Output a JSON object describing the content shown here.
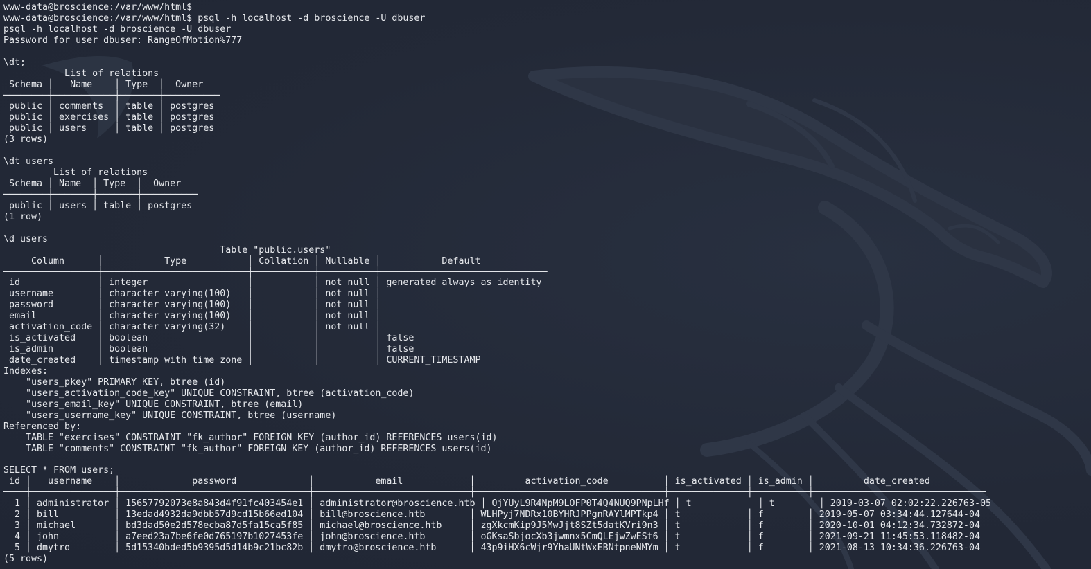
{
  "terminal": {
    "lines": [
      "www-data@broscience:/var/www/html$",
      "www-data@broscience:/var/www/html$ psql -h localhost -d broscience -U dbuser",
      "psql -h localhost -d broscience -U dbuser",
      "Password for user dbuser: RangeOfMotion%777",
      "",
      "\\dt;",
      "           List of relations",
      " Schema │   Name    │ Type  │  Owner",
      "────────┼───────────┼───────┼──────────",
      " public │ comments  │ table │ postgres",
      " public │ exercises │ table │ postgres",
      " public │ users     │ table │ postgres",
      "(3 rows)",
      "",
      "\\dt users",
      "         List of relations",
      " Schema │ Name  │ Type  │  Owner",
      "────────┼───────┼───────┼──────────",
      " public │ users │ table │ postgres",
      "(1 row)",
      "",
      "\\d users",
      "                                       Table \"public.users\"",
      "     Column      │           Type           │ Collation │ Nullable │           Default",
      "─────────────────┼──────────────────────────┼───────────┼──────────┼──────────────────────────────",
      " id              │ integer                  │           │ not null │ generated always as identity",
      " username        │ character varying(100)   │           │ not null │",
      " password        │ character varying(100)   │           │ not null │",
      " email           │ character varying(100)   │           │ not null │",
      " activation_code │ character varying(32)    │           │ not null │",
      " is_activated    │ boolean                  │           │          │ false",
      " is_admin        │ boolean                  │           │          │ false",
      " date_created    │ timestamp with time zone │           │          │ CURRENT_TIMESTAMP",
      "Indexes:",
      "    \"users_pkey\" PRIMARY KEY, btree (id)",
      "    \"users_activation_code_key\" UNIQUE CONSTRAINT, btree (activation_code)",
      "    \"users_email_key\" UNIQUE CONSTRAINT, btree (email)",
      "    \"users_username_key\" UNIQUE CONSTRAINT, btree (username)",
      "Referenced by:",
      "    TABLE \"exercises\" CONSTRAINT \"fk_author\" FOREIGN KEY (author_id) REFERENCES users(id)",
      "    TABLE \"comments\" CONSTRAINT \"fk_author\" FOREIGN KEY (author_id) REFERENCES users(id)",
      "",
      "SELECT * FROM users;",
      " id │   username    │             password             │           email            │         activation_code          │ is_activated │ is_admin │         date_created",
      "────┼───────────────┼──────────────────────────────────┼────────────────────────────┼──────────────────────────────────┼──────────────┼──────────┼───────────────────────────────",
      "  1 │ administrator │ 15657792073e8a843d4f91fc403454e1 │ administrator@broscience.htb │ OjYUyL9R4NpM9LOFP0T4Q4NUQ9PNpLHf │ t            │ t        │ 2019-03-07 02:02:22.226763-05",
      "  2 │ bill          │ 13edad4932da9dbb57d9cd15b66ed104 │ bill@broscience.htb        │ WLHPyj7NDRx10BYHRJPPgnRAYlMPTkp4 │ t            │ f        │ 2019-05-07 03:34:44.127644-04",
      "  3 │ michael       │ bd3dad50e2d578ecba87d5fa15ca5f85 │ michael@broscience.htb     │ zgXkcmKip9J5MwJjt8SZt5datKVri9n3 │ t            │ f        │ 2020-10-01 04:12:34.732872-04",
      "  4 │ john          │ a7eed23a7be6fe0d765197b1027453fe │ john@broscience.htb        │ oGKsaSbjocXb3jwmnx5CmQLEjwZwESt6 │ t            │ f        │ 2021-09-21 11:45:53.118482-04",
      "  5 │ dmytro        │ 5d15340bded5b9395d5d14b9c21bc82b │ dmytro@broscience.htb      │ 43p9iHX6cWjr9YhaUNtWxEBNtpneNMYm │ t            │ f        │ 2021-08-13 10:34:36.226763-04",
      "(5 rows)"
    ]
  },
  "colors": {
    "background": "#232937",
    "foreground": "#e6e8ec",
    "watermark": "#2f3747"
  },
  "icons": {
    "watermark": "kali-dragon-icon"
  }
}
